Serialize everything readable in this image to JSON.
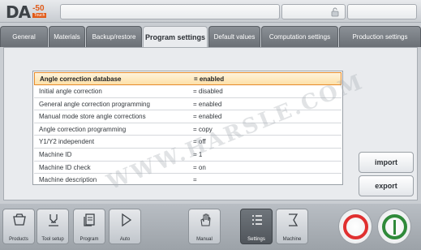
{
  "header": {
    "logo_text": "DA",
    "logo_model": "-50",
    "logo_sub": "Touch"
  },
  "tabs": [
    {
      "label": "General"
    },
    {
      "label": "Materials"
    },
    {
      "label": "Backup/restore"
    },
    {
      "label": "Program settings",
      "active": true
    },
    {
      "label": "Default values"
    },
    {
      "label": "Computation settings"
    },
    {
      "label": "Production settings"
    }
  ],
  "settings": [
    {
      "name": "Angle correction database",
      "value": "= enabled",
      "selected": true
    },
    {
      "name": "Initial angle correction",
      "value": "= disabled"
    },
    {
      "name": "General angle correction programming",
      "value": "= enabled"
    },
    {
      "name": "Manual mode store angle corrections",
      "value": "= enabled"
    },
    {
      "name": "Angle correction programming",
      "value": "= copy"
    },
    {
      "name": "Y1/Y2 independent",
      "value": "= off"
    },
    {
      "name": "Machine ID",
      "value": "= 1"
    },
    {
      "name": "Machine ID check",
      "value": "= on"
    },
    {
      "name": "Machine description",
      "value": "="
    }
  ],
  "watermark": "WWW.HARSLE.COM",
  "side_buttons": {
    "import_label": "import",
    "export_label": "export"
  },
  "nav": [
    {
      "label": "Products",
      "icon": "products-icon"
    },
    {
      "label": "Tool setup",
      "icon": "tool-setup-icon"
    },
    {
      "label": "Program",
      "icon": "program-icon"
    },
    {
      "label": "Auto",
      "icon": "auto-play-icon"
    },
    {
      "label": "Manual",
      "icon": "manual-hand-icon"
    },
    {
      "label": "Settings",
      "icon": "settings-list-icon",
      "active": true
    },
    {
      "label": "Machine",
      "icon": "machine-icon"
    }
  ],
  "colors": {
    "accent_orange": "#e58a2a",
    "stop_red": "#e03030",
    "start_green": "#2f8a3a"
  }
}
